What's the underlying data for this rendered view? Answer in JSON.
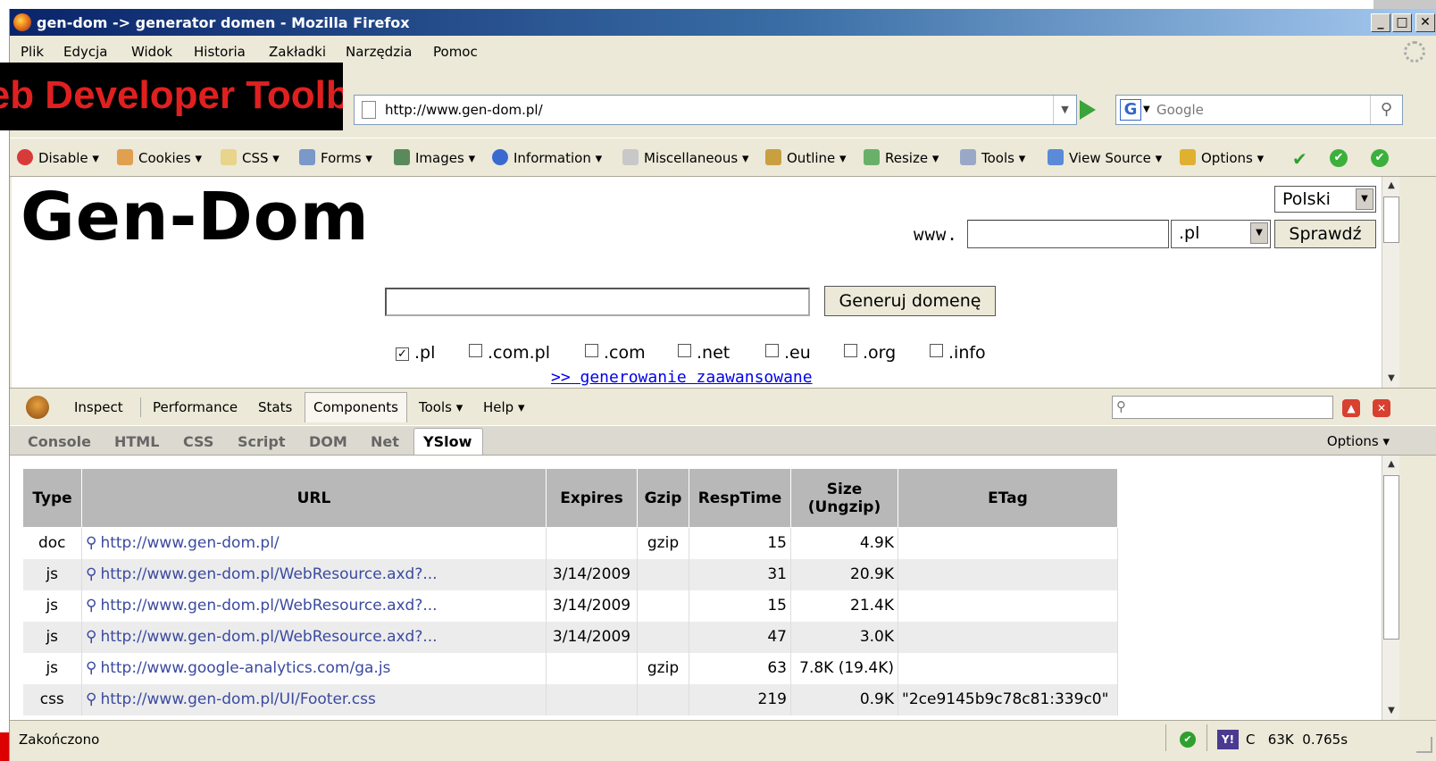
{
  "window": {
    "title": "gen-dom -> generator domen - Mozilla Firefox",
    "min_label": "_",
    "max_label": "□",
    "close_label": "✕"
  },
  "menu": [
    "Plik",
    "Edycja",
    "Widok",
    "Historia",
    "Zakładki",
    "Narzędzia",
    "Pomoc"
  ],
  "overlay_banner": "Web Developer Toolbar",
  "navigation": {
    "url": "http://www.gen-dom.pl/",
    "search_engine": "G",
    "search_placeholder": "Google"
  },
  "web_developer_toolbar": {
    "items": [
      {
        "label": "Disable",
        "icon": "disable-icon",
        "color": "#d83a3a"
      },
      {
        "label": "Cookies",
        "icon": "cookies-icon",
        "color": "#e0a050"
      },
      {
        "label": "CSS",
        "icon": "css-icon",
        "color": "#e8d48a"
      },
      {
        "label": "Forms",
        "icon": "forms-icon",
        "color": "#7a98c8"
      },
      {
        "label": "Images",
        "icon": "images-icon",
        "color": "#5a8a5a"
      },
      {
        "label": "Information",
        "icon": "information-icon",
        "color": "#3a6ad0"
      },
      {
        "label": "Miscellaneous",
        "icon": "miscellaneous-icon",
        "color": "#c8c8c8"
      },
      {
        "label": "Outline",
        "icon": "outline-icon",
        "color": "#c8a040"
      },
      {
        "label": "Resize",
        "icon": "resize-icon",
        "color": "#6ab06a"
      },
      {
        "label": "Tools",
        "icon": "tools-icon",
        "color": "#9aa8c8"
      },
      {
        "label": "View Source",
        "icon": "view-source-icon",
        "color": "#5a8ad8"
      },
      {
        "label": "Options",
        "icon": "options-icon",
        "color": "#e0b030"
      }
    ],
    "status_check": "✔",
    "status_valid_1": "✔",
    "status_valid_2": "✔"
  },
  "page": {
    "logo": "Gen-Dom",
    "language": "Polski",
    "www_label": "www.",
    "tld_selected": ".pl",
    "check_button": "Sprawdź",
    "generate_button": "Generuj domenę",
    "tld_options": [
      {
        "label": ".pl",
        "checked": true
      },
      {
        "label": ".com.pl",
        "checked": false
      },
      {
        "label": ".com",
        "checked": false
      },
      {
        "label": ".net",
        "checked": false
      },
      {
        "label": ".eu",
        "checked": false
      },
      {
        "label": ".org",
        "checked": false
      },
      {
        "label": ".info",
        "checked": false
      }
    ],
    "advanced_link": ">> generowanie zaawansowane"
  },
  "firebug": {
    "toolbar": [
      "Inspect",
      "Performance",
      "Stats",
      "Components",
      "Tools ▾",
      "Help ▾"
    ],
    "active_toolbar": "Components",
    "tabs": [
      "Console",
      "HTML",
      "CSS",
      "Script",
      "DOM",
      "Net",
      "YSlow"
    ],
    "active_tab": "YSlow",
    "options": "Options ▾",
    "collapse_label": "▲",
    "close_label": "✕"
  },
  "yslow": {
    "headers": {
      "type": "Type",
      "url": "URL",
      "expires": "Expires",
      "gzip": "Gzip",
      "resptime": "RespTime",
      "size_line1": "Size",
      "size_line2": "(Ungzip)",
      "etag": "ETag"
    },
    "rows": [
      {
        "type": "doc",
        "url": "http://www.gen-dom.pl/",
        "expires": "",
        "gzip": "gzip",
        "resptime": "15",
        "size": "4.9K",
        "etag": ""
      },
      {
        "type": "js",
        "url": "http://www.gen-dom.pl/WebResource.axd?...",
        "expires": "3/14/2009",
        "gzip": "",
        "resptime": "31",
        "size": "20.9K",
        "etag": ""
      },
      {
        "type": "js",
        "url": "http://www.gen-dom.pl/WebResource.axd?...",
        "expires": "3/14/2009",
        "gzip": "",
        "resptime": "15",
        "size": "21.4K",
        "etag": ""
      },
      {
        "type": "js",
        "url": "http://www.gen-dom.pl/WebResource.axd?...",
        "expires": "3/14/2009",
        "gzip": "",
        "resptime": "47",
        "size": "3.0K",
        "etag": ""
      },
      {
        "type": "js",
        "url": "http://www.google-analytics.com/ga.js",
        "expires": "",
        "gzip": "gzip",
        "resptime": "63",
        "size": "7.8K (19.4K)",
        "etag": ""
      },
      {
        "type": "css",
        "url": "http://www.gen-dom.pl/UI/Footer.css",
        "expires": "",
        "gzip": "",
        "resptime": "219",
        "size": "0.9K",
        "etag": "\"2ce9145b9c78c81:339c0\""
      }
    ]
  },
  "statusbar": {
    "text": "Zakończono",
    "grade": "C",
    "size": "63K",
    "time": "0.765s"
  }
}
